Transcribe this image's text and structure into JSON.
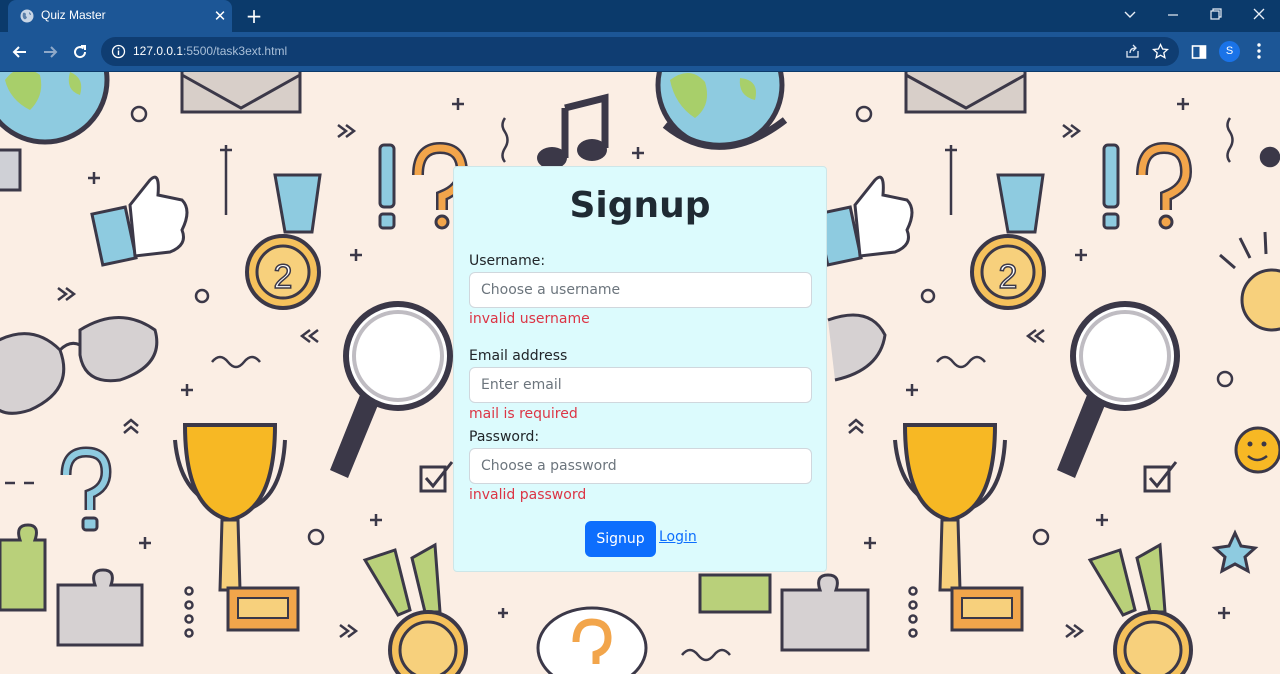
{
  "browser": {
    "tab_title": "Quiz Master",
    "url_host": "127.0.0.1",
    "url_path": ":5500/task3ext.html",
    "profile_initial": "S"
  },
  "signup": {
    "title": "Signup",
    "username": {
      "label": "Username:",
      "placeholder": "Choose a username",
      "error": "invalid username"
    },
    "email": {
      "label": "Email address",
      "placeholder": "Enter email",
      "error": "mail is required"
    },
    "password": {
      "label": "Password:",
      "placeholder": "Choose a password",
      "error": "invalid password"
    },
    "submit_label": "Signup",
    "login_link": "Login"
  },
  "colors": {
    "card_bg": "#dcfbfd",
    "primary": "#0d6efd",
    "error": "#dc3545",
    "page_bg": "#fbeee4"
  },
  "icons": [
    "globe-icon",
    "close-icon",
    "plus-icon",
    "back-arrow-icon",
    "forward-arrow-icon",
    "reload-icon",
    "info-icon",
    "share-icon",
    "star-icon",
    "sidebar-icon",
    "menu-dots-icon"
  ]
}
